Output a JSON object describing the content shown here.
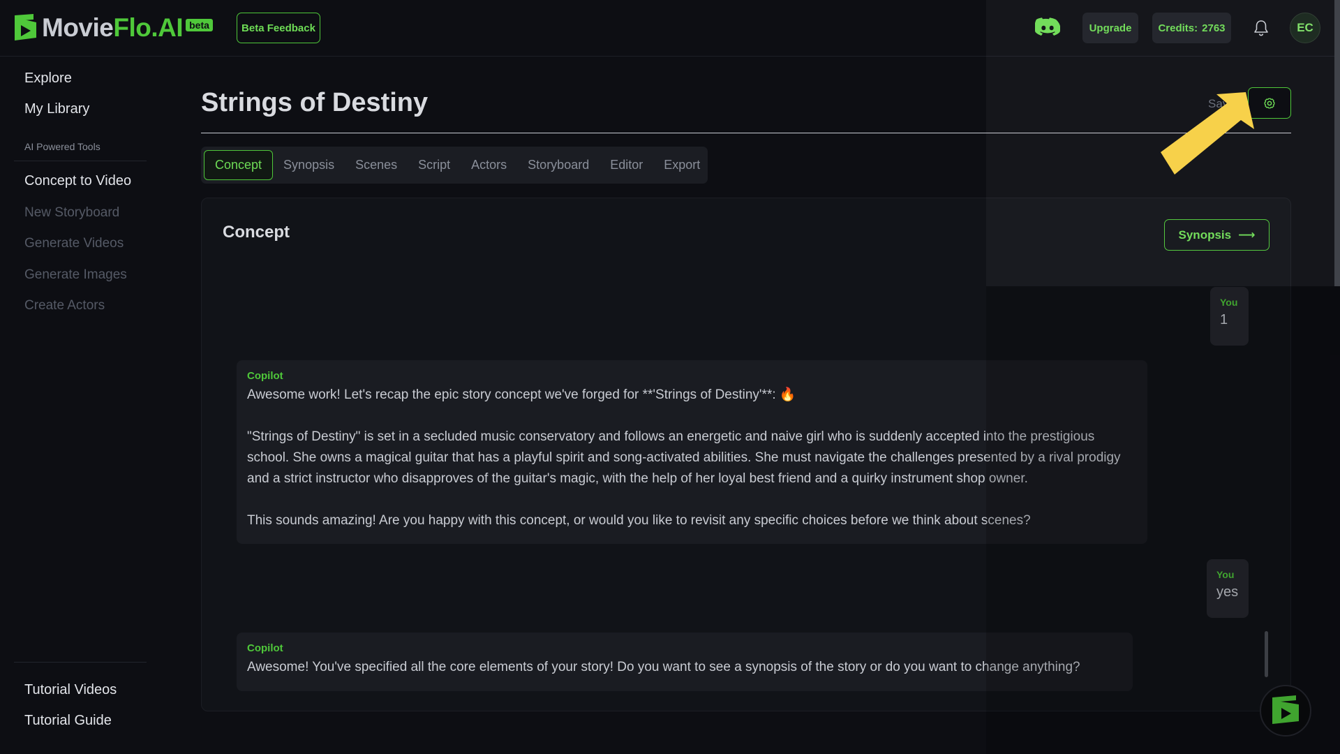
{
  "header": {
    "logo_prefix": "Movie",
    "logo_accent": "Flo.AI",
    "logo_badge": "beta",
    "beta_feedback": "Beta Feedback",
    "upgrade": "Upgrade",
    "credits_label": "Credits:",
    "credits_value": "2763",
    "avatar": "EC",
    "accent_color": "#4fc83a"
  },
  "sidebar": {
    "top_items": [
      "Explore",
      "My Library"
    ],
    "section_label": "AI Powered Tools",
    "tools": [
      "Concept to Video",
      "New Storyboard",
      "Generate Videos",
      "Generate Images",
      "Create Actors"
    ],
    "bottom_items": [
      "Tutorial Videos",
      "Tutorial Guide"
    ]
  },
  "main": {
    "title": "Strings of Destiny",
    "saved_status": "Saved",
    "tabs": [
      "Concept",
      "Synopsis",
      "Scenes",
      "Script",
      "Actors",
      "Storyboard",
      "Editor",
      "Export"
    ],
    "active_tab": "Concept",
    "card_title": "Concept",
    "next_button": "Synopsis",
    "next_arrow": "⟶"
  },
  "chat": [
    {
      "role": "You",
      "text": "1"
    },
    {
      "role": "Copilot",
      "paragraphs": [
        "Awesome work! Let's recap the epic story concept we've forged for **'Strings of Destiny'**: 🔥",
        "\"Strings of Destiny\" is set in a secluded music conservatory and follows an energetic and naive girl who is suddenly accepted into the prestigious school. She owns a magical guitar that has a playful spirit and song-activated abilities. She must navigate the challenges presented by a rival prodigy and a strict instructor who disapproves of the guitar's magic, with the help of her loyal best friend and a quirky instrument shop owner.",
        "This sounds amazing! Are you happy with this concept, or would you like to revisit any specific choices before we think about scenes?"
      ]
    },
    {
      "role": "You",
      "text": "yes"
    },
    {
      "role": "Copilot",
      "paragraphs": [
        "Awesome! You've specified all the core elements of your story! Do you want to see a synopsis of the story or do you want to change anything?"
      ]
    }
  ]
}
